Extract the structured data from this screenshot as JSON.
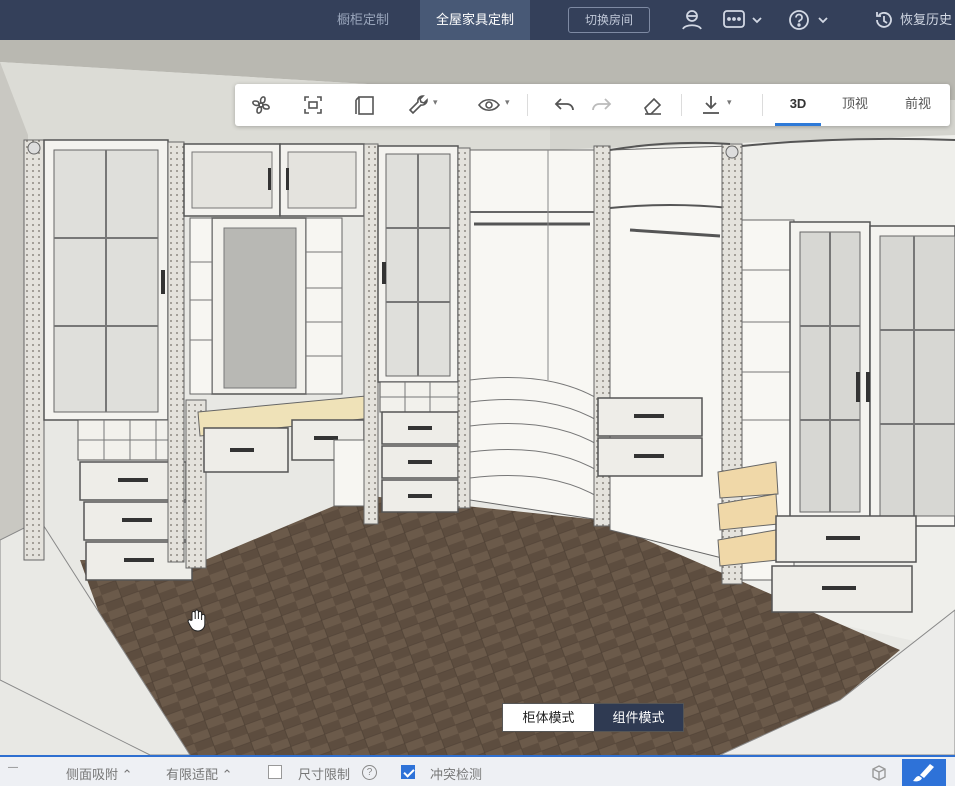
{
  "topbar": {
    "tab_cabinet": "橱柜定制",
    "tab_wholehouse": "全屋家具定制",
    "switch_room": "切换房间",
    "restore_history": "恢复历史"
  },
  "toolbar": {
    "icons": [
      "fan-icon",
      "focus-frame-icon",
      "rotate-cabinet-icon",
      "wrench-icon",
      "eye-icon",
      "undo-icon",
      "redo-icon",
      "eraser-icon",
      "download-icon"
    ],
    "view_tabs": [
      "3D",
      "顶视",
      "前视"
    ],
    "active_view": "3D"
  },
  "mode_switch": {
    "cabinet_mode": "柜体模式",
    "component_mode": "组件模式",
    "active": "组件模式"
  },
  "statusbar": {
    "side_snap": "侧面吸附",
    "limited_fit": "有限适配",
    "size_limit": "尺寸限制",
    "collision_check": "冲突检测",
    "size_limit_checked": false,
    "collision_check_checked": true,
    "help": "?"
  },
  "colors": {
    "accent": "#2e72d8",
    "topbar_bg": "#34405a",
    "floor": "#5a4a3c",
    "cabinet": "#f3f1ec"
  }
}
